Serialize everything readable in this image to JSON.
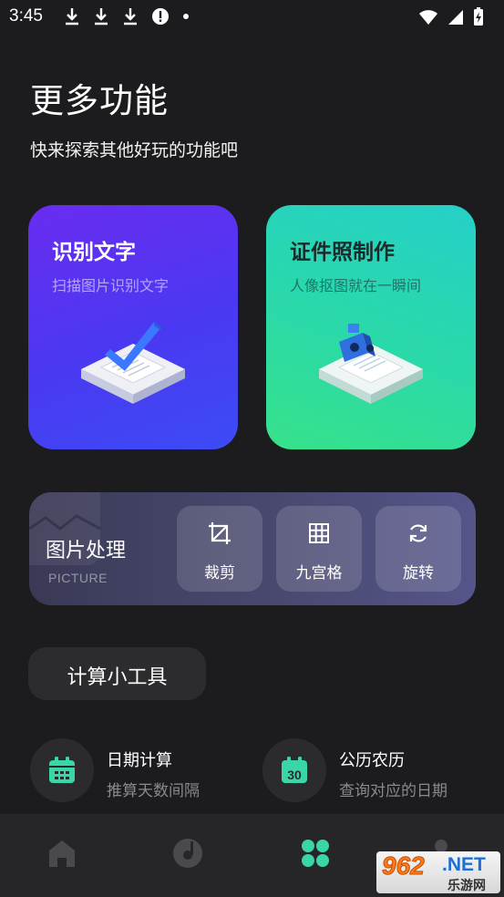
{
  "status_bar": {
    "time": "3:45",
    "left_icons": [
      "download-icon",
      "download-icon",
      "download-icon",
      "alert-icon",
      "dot-icon"
    ],
    "right_icons": [
      "wifi-icon",
      "signal-icon",
      "battery-charging-icon"
    ]
  },
  "header": {
    "title": "更多功能",
    "subtitle": "快来探索其他好玩的功能吧"
  },
  "cards": [
    {
      "title": "识别文字",
      "desc": "扫描图片识别文字",
      "icon": "document-check-icon",
      "gradient": [
        "#6a2cf0",
        "#3c4cf4"
      ]
    },
    {
      "title": "证件照制作",
      "desc": "人像抠图就在一瞬间",
      "icon": "document-camera-icon",
      "gradient": [
        "#25d0c8",
        "#37e28a"
      ]
    }
  ],
  "picture_tools": {
    "title": "图片处理",
    "subtitle": "PICTURE",
    "tools": [
      {
        "label": "裁剪",
        "icon": "crop-icon"
      },
      {
        "label": "九宫格",
        "icon": "grid-icon"
      },
      {
        "label": "旋转",
        "icon": "rotate-icon"
      }
    ]
  },
  "calc_section": {
    "label": "计算小工具"
  },
  "utilities": [
    {
      "name": "日期计算",
      "desc": "推算天数间隔",
      "icon": "calendar-icon",
      "color": "#3ad6a8"
    },
    {
      "name": "公历农历",
      "desc": "查询对应的日期",
      "icon": "calendar-30-icon",
      "color": "#3ad6a8",
      "icon_text": "30"
    }
  ],
  "bottom_nav": [
    {
      "name": "home",
      "icon": "home-icon",
      "active": false
    },
    {
      "name": "music",
      "icon": "disc-icon",
      "active": false
    },
    {
      "name": "more",
      "icon": "apps-grid-icon",
      "active": true
    },
    {
      "name": "profile",
      "icon": "person-icon",
      "active": false
    }
  ],
  "watermark": {
    "number": "962",
    "net": ".NET",
    "cn": "乐游网"
  },
  "colors": {
    "background": "#1c1c1e",
    "accent": "#3ad6a8",
    "nav_bg": "#262628"
  }
}
